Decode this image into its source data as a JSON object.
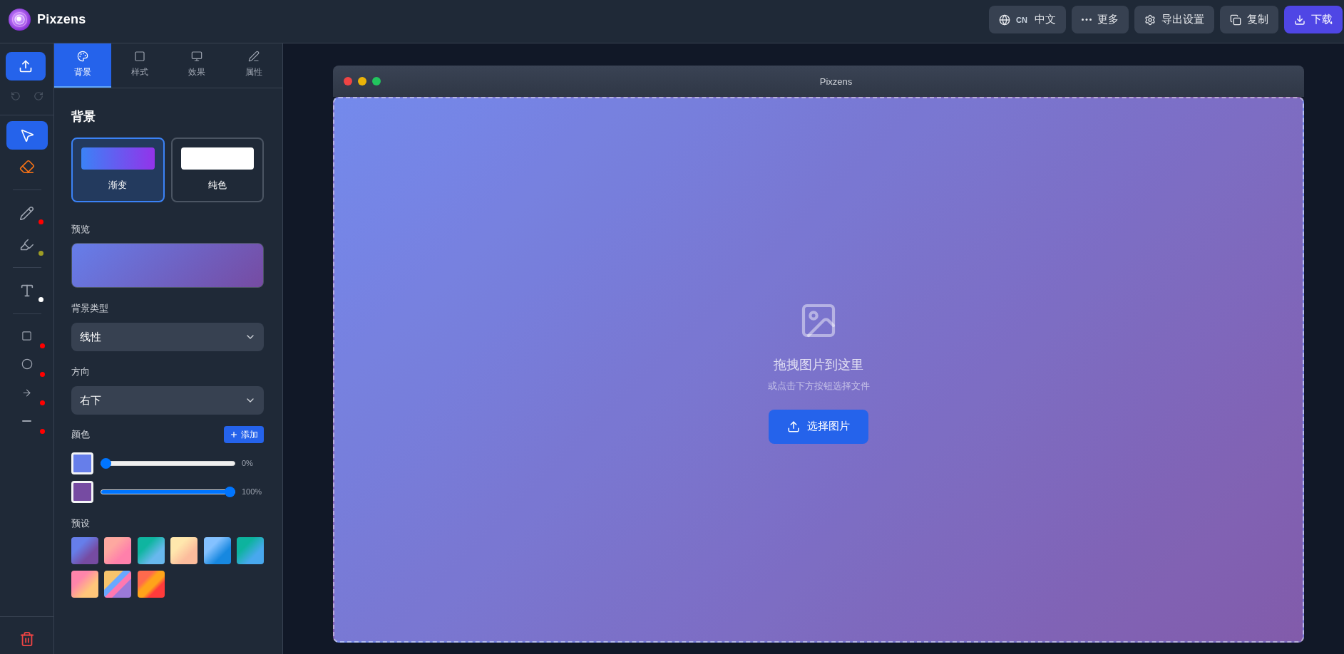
{
  "app": {
    "name": "Pixzens"
  },
  "header_actions": [
    {
      "kind": "language",
      "code": "CN",
      "label": "中文",
      "primary": false
    },
    {
      "kind": "more",
      "label": "更多",
      "primary": false
    },
    {
      "kind": "settings",
      "label": "导出设置",
      "primary": false
    },
    {
      "kind": "copy",
      "label": "复制",
      "primary": false
    },
    {
      "kind": "download",
      "label": "下载",
      "primary": true
    }
  ],
  "history": [
    {
      "kind": "undo",
      "disabled": true
    },
    {
      "kind": "redo",
      "disabled": true
    }
  ],
  "tool_groups": [
    {
      "tools": [
        {
          "kind": "select",
          "selected": true
        },
        {
          "kind": "eraser",
          "selected": false
        }
      ]
    },
    {
      "tools": [
        {
          "kind": "pencil",
          "selected": false,
          "color": "#ff0000"
        },
        {
          "kind": "highlighter",
          "selected": false,
          "color": "#9e9d24"
        }
      ]
    },
    {
      "tools": [
        {
          "kind": "text",
          "selected": false,
          "color": "#ffffff"
        }
      ]
    },
    {
      "tools": [
        {
          "kind": "rectangle",
          "selected": false,
          "color": "#ff0000"
        },
        {
          "kind": "circle",
          "selected": false,
          "color": "#ff0000"
        },
        {
          "kind": "arrow",
          "selected": false,
          "color": "#ff0000"
        },
        {
          "kind": "line",
          "selected": false,
          "color": "#ff0000"
        }
      ]
    }
  ],
  "panel": {
    "tabs": [
      {
        "label": "背景",
        "selected": true
      },
      {
        "label": "样式",
        "selected": false
      },
      {
        "label": "效果",
        "selected": false
      },
      {
        "label": "属性",
        "selected": false
      }
    ],
    "title": "背景",
    "background_types": [
      {
        "kind": "gradient",
        "label": "渐变",
        "selected": true
      },
      {
        "kind": "solid",
        "label": "纯色",
        "selected": false
      }
    ],
    "preview_label": "预览",
    "fields": [
      {
        "label": "背景类型",
        "value": "线性"
      },
      {
        "label": "方向",
        "value": "右下"
      }
    ],
    "colors_label": "颜色",
    "add_button": "添加",
    "color_stops": [
      {
        "color": "#667eea",
        "level": 0,
        "reading": "0%"
      },
      {
        "color": "#764ba2",
        "level": 1,
        "reading": "100%"
      }
    ],
    "presets_label": "预设",
    "presets": [
      {
        "stops": [
          {
            "color": "#667eea"
          },
          {
            "color": "#764ba2"
          }
        ]
      },
      {
        "stops": [
          {
            "color": "#fea8a0"
          },
          {
            "color": "#ff80ab"
          }
        ]
      },
      {
        "stops": [
          {
            "color": "#0fb5a0"
          },
          {
            "color": "#68b8ee"
          }
        ]
      },
      {
        "stops": [
          {
            "color": "#ffe7ad"
          },
          {
            "color": "#fcbc9c"
          }
        ]
      },
      {
        "stops": [
          {
            "color": "#84c1ff"
          },
          {
            "color": "#1788e0"
          }
        ]
      },
      {
        "stops": [
          {
            "color": "#0db39e"
          },
          {
            "color": "#48a8ee"
          }
        ]
      },
      {
        "stops": [
          {
            "color": "#ff85ab"
          },
          {
            "color": "#ffc67a"
          }
        ]
      },
      {
        "stops": [
          {
            "color": "#f7c46c"
          },
          {
            "color": "#6aa8ff"
          },
          {
            "color": "#ff78b0"
          },
          {
            "color": "#9b7ad8"
          }
        ]
      },
      {
        "stops": [
          {
            "color": "#ff6a4d"
          },
          {
            "color": "#ffa41a"
          },
          {
            "color": "#ff3b3b"
          }
        ]
      }
    ]
  },
  "canvas": {
    "window_controls": [
      {
        "color": "#ef4444"
      },
      {
        "color": "#eab308"
      },
      {
        "color": "#22c55e"
      }
    ],
    "window_title": "Pixzens",
    "drop_title": "拖拽图片到这里",
    "drop_hint": "或点击下方按钮选择文件",
    "select_button": "选择图片"
  }
}
